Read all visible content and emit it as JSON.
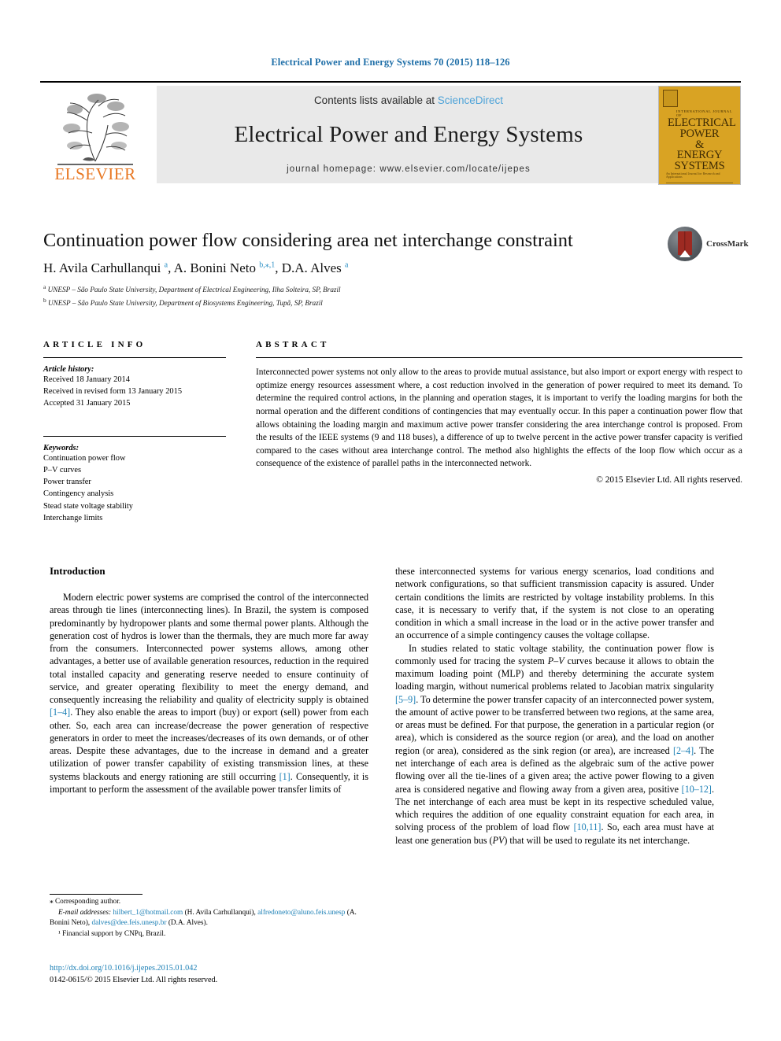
{
  "running_head": "Electrical Power and Energy Systems 70 (2015) 118–126",
  "banner": {
    "contents_prefix": "Contents lists available at ",
    "sciencedirect": "ScienceDirect",
    "journal_title": "Electrical Power and Energy Systems",
    "homepage": "journal homepage: www.elsevier.com/locate/ijepes",
    "publisher_logo": "ELSEVIER",
    "cover": {
      "line_ij": "INTERNATIONAL JOURNAL OF",
      "word1": "ELECTRICAL",
      "word2": "POWER",
      "word3": "&",
      "word4": "ENERGY",
      "word5": "SYSTEMS",
      "foot": "An International Journal for Research and Applications"
    }
  },
  "article": {
    "title": "Continuation power flow considering area net interchange constraint",
    "crossmark_label": "CrossMark",
    "authors_html": "H. Avila Carhullanqui <sup>a</sup>, A. Bonini Neto <sup>b,∗,1</sup>, D.A. Alves <sup>a</sup>",
    "affiliation_a": "UNESP – São Paulo State University, Department of Electrical Engineering, Ilha Solteira, SP, Brazil",
    "affiliation_b": "UNESP – São Paulo State University, Department of Biosystems Engineering, Tupã, SP, Brazil"
  },
  "article_info": {
    "heading": "ARTICLE INFO",
    "history_label": "Article history:",
    "history": [
      "Received 18 January 2014",
      "Received in revised form 13 January 2015",
      "Accepted 31 January 2015"
    ],
    "keywords_label": "Keywords:",
    "keywords": [
      "Continuation power flow",
      "P–V curves",
      "Power transfer",
      "Contingency analysis",
      "Stead state voltage stability",
      "Interchange limits"
    ]
  },
  "abstract": {
    "heading": "ABSTRACT",
    "text": "Interconnected power systems not only allow to the areas to provide mutual assistance, but also import or export energy with respect to optimize energy resources assessment where, a cost reduction involved in the generation of power required to meet its demand. To determine the required control actions, in the planning and operation stages, it is important to verify the loading margins for both the normal operation and the different conditions of contingencies that may eventually occur. In this paper a continuation power flow that allows obtaining the loading margin and maximum active power transfer considering the area interchange control is proposed. From the results of the IEEE systems (9 and 118 buses), a difference of up to twelve percent in the active power transfer capacity is verified compared to the cases without area interchange control. The method also highlights the effects of the loop flow which occur as a consequence of the existence of parallel paths in the interconnected network.",
    "copyright": "© 2015 Elsevier Ltd. All rights reserved."
  },
  "introduction": {
    "heading": "Introduction",
    "left_p1_a": "Modern electric power systems are comprised the control of the interconnected areas through tie lines (interconnecting lines). In Brazil, the system is composed predominantly by hydropower plants and some thermal power plants. Although the generation cost of hydros is lower than the thermals, they are much more far away from the consumers. Interconnected power systems allows, among other advantages, a better use of available generation resources, reduction in the required total installed capacity and generating reserve needed to ensure continuity of service, and greater operating flexibility to meet the energy demand, and consequently increasing the reliability and quality of electricity supply is obtained ",
    "left_ref1": "[1–4]",
    "left_p1_b": ". They also enable the areas to import (buy) or export (sell) power from each other. So, each area can increase/decrease the power generation of respective generators in order to meet the increases/decreases of its own demands, or of other areas. Despite these advantages, due to the increase in demand and a greater utilization of power transfer capability of existing transmission lines, at these systems blackouts and energy rationing are still occurring ",
    "left_ref2": "[1]",
    "left_p1_c": ". Consequently, it is important to perform the assessment of the available power transfer limits of",
    "right_p1": "these interconnected systems for various energy scenarios, load conditions and network configurations, so that sufficient transmission capacity is assured. Under certain conditions the limits are restricted by voltage instability problems. In this case, it is necessary to verify that, if the system is not close to an operating condition in which a small increase in the load or in the active power transfer and an occurrence of a simple contingency causes the voltage collapse.",
    "right_p2_a": "In studies related to static voltage stability, the continuation power flow is commonly used for tracing the system ",
    "right_pv1": "P–V",
    "right_p2_b": " curves because it allows to obtain the maximum loading point (MLP) and thereby determining the accurate system loading margin, without numerical problems related to Jacobian matrix singularity ",
    "right_ref1": "[5–9]",
    "right_p2_c": ". To determine the power transfer capacity of an interconnected power system, the amount of active power to be transferred between two regions, at the same area, or areas must be defined. For that purpose, the generation in a particular region (or area), which is considered as the source region (or area), and the load on another region (or area), considered as the sink region (or area), are increased ",
    "right_ref2": "[2–4]",
    "right_p2_d": ". The net interchange of each area is defined as the algebraic sum of the active power flowing over all the tie-lines of a given area; the active power flowing to a given area is considered negative and flowing away from a given area, positive ",
    "right_ref3": "[10–12]",
    "right_p2_e": ". The net interchange of each area must be kept in its respective scheduled value, which requires the addition of one equality constraint equation for each area, in solving process of the problem of load flow ",
    "right_ref4": "[10,11]",
    "right_p2_f": ". So, each area must have at least one generation bus (",
    "right_pv2": "PV",
    "right_p2_g": ") that will be used to regulate its net interchange."
  },
  "footnotes": {
    "corresponding": "⁎ Corresponding author.",
    "email_label": "E-mail addresses:",
    "email1": "hilbert_1@hotmail.com",
    "email1_owner": " (H. Avila Carhullanqui), ",
    "email2": "alfredoneto@aluno.feis.unesp",
    "email2_owner": " (A. Bonini Neto), ",
    "email3": "dalves@dee.feis.unesp.br",
    "email3_owner": " (D.A. Alves).",
    "footnote1": "¹ Financial support by CNPq, Brazil.",
    "doi": "http://dx.doi.org/10.1016/j.ijepes.2015.01.042",
    "issn": "0142-0615/© 2015 Elsevier Ltd. All rights reserved."
  },
  "colors": {
    "link": "#1b7fb5",
    "running_head": "#1f6fa8",
    "cover_bg": "#d9a323",
    "elsevier_orange": "#e87722"
  }
}
